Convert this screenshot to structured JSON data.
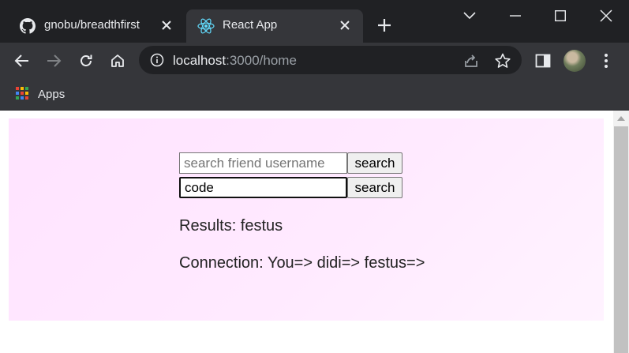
{
  "browser": {
    "tabs": [
      {
        "title": "gnobu/breadthfirst",
        "favicon": "github-icon",
        "active": false
      },
      {
        "title": "React App",
        "favicon": "react-icon",
        "active": true
      }
    ],
    "address": {
      "host": "localhost",
      "rest": ":3000/home"
    },
    "bookmarks": [
      {
        "label": "Apps"
      }
    ]
  },
  "page": {
    "search_friend": {
      "placeholder": "search friend username",
      "value": "",
      "button": "search"
    },
    "search_code": {
      "placeholder": "",
      "value": "code",
      "button": "search"
    },
    "results": "Results: festus",
    "connection": "Connection: You=> didi=> festus=>"
  },
  "colors": {
    "panel_background": "#ffe6ff",
    "chrome_dark": "#202124",
    "chrome_toolbar": "#35363a"
  }
}
